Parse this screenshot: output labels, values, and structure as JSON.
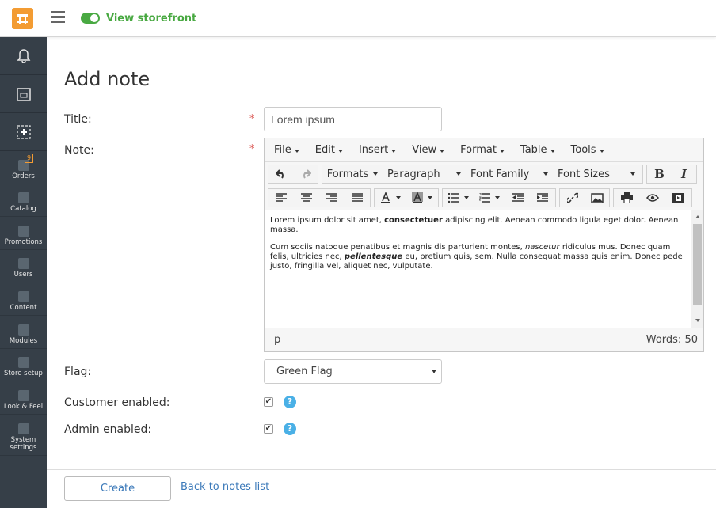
{
  "topbar": {
    "view_storefront": "View storefront"
  },
  "sidebar": {
    "items": [
      {
        "label": "Orders",
        "badge": "9",
        "icon": "orders-icon"
      },
      {
        "label": "Catalog",
        "icon": "catalog-icon"
      },
      {
        "label": "Promotions",
        "icon": "promotions-icon"
      },
      {
        "label": "Users",
        "icon": "users-icon"
      },
      {
        "label": "Content",
        "icon": "content-icon"
      },
      {
        "label": "Modules",
        "icon": "modules-icon"
      },
      {
        "label": "Store setup",
        "icon": "store-setup-icon"
      },
      {
        "label": "Look & Feel",
        "icon": "look-feel-icon"
      },
      {
        "label": "System settings",
        "icon": "system-settings-icon"
      }
    ]
  },
  "page": {
    "title": "Add note"
  },
  "form": {
    "title_label": "Title:",
    "title_value": "Lorem ipsum",
    "note_label": "Note:",
    "required_mark": "*",
    "flag_label": "Flag:",
    "flag_value": "Green Flag",
    "customer_enabled_label": "Customer enabled:",
    "admin_enabled_label": "Admin enabled:",
    "customer_enabled": true,
    "admin_enabled": true
  },
  "editor": {
    "menu": [
      "File",
      "Edit",
      "Insert",
      "View",
      "Format",
      "Table",
      "Tools"
    ],
    "formats": "Formats",
    "paragraph": "Paragraph",
    "font_family": "Font Family",
    "font_sizes": "Font Sizes",
    "para1": {
      "a": "Lorem ipsum dolor sit amet, ",
      "b": "consectetuer",
      "c": " adipiscing elit. Aenean commodo ligula eget dolor. Aenean massa."
    },
    "para2": {
      "a": "Cum sociis natoque penatibus et magnis dis parturient montes, ",
      "b": "nascetur",
      "c": " ridiculus mus. Donec quam felis, ultricies nec, ",
      "d": "pellentesque",
      "e": " eu, pretium quis, sem. Nulla consequat massa quis enim. Donec pede justo, fringilla vel, aliquet nec, vulputate."
    },
    "path": "p",
    "words": "Words: 50"
  },
  "footer": {
    "create": "Create",
    "back": "Back to notes list"
  },
  "colors": {
    "accent": "#49a942",
    "brand": "#f39c33",
    "sidebar": "#363f48",
    "link": "#3b79b9"
  }
}
